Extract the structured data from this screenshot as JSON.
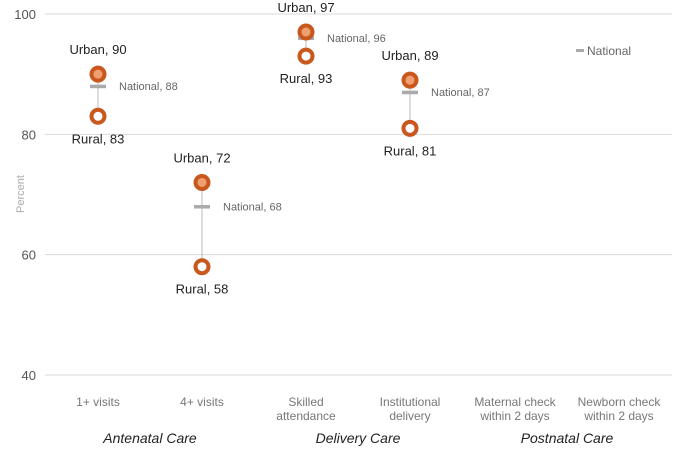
{
  "chart_data": {
    "type": "scatter",
    "ylabel": "Percent",
    "ylim": [
      40,
      100
    ],
    "yticks": [
      "40",
      "60",
      "80",
      "100"
    ],
    "grid": true,
    "legend_position": "top-right",
    "categories": [
      {
        "lines": [
          "1+ visits"
        ]
      },
      {
        "lines": [
          "4+ visits"
        ]
      },
      {
        "lines": [
          "Skilled",
          "attendance"
        ]
      },
      {
        "lines": [
          "Institutional",
          "delivery"
        ]
      },
      {
        "lines": [
          "Maternal check",
          "within 2 days"
        ]
      },
      {
        "lines": [
          "Newborn check",
          "within 2 days"
        ]
      }
    ],
    "groups": [
      {
        "label": "Antenatal Care",
        "categories": [
          0,
          1
        ]
      },
      {
        "label": "Delivery Care",
        "categories": [
          2,
          3
        ]
      },
      {
        "label": "Postnatal Care",
        "categories": [
          4,
          5
        ]
      }
    ],
    "series": [
      {
        "name": "Urban",
        "values": [
          90,
          72,
          97,
          89,
          null,
          null
        ],
        "labels": [
          "Urban, 90",
          "Urban, 72",
          "Urban, 97",
          "Urban, 89",
          null,
          null
        ]
      },
      {
        "name": "Rural",
        "values": [
          83,
          58,
          93,
          81,
          null,
          null
        ],
        "labels": [
          "Rural, 83",
          "Rural, 58",
          "Rural, 93",
          "Rural, 81",
          null,
          null
        ]
      },
      {
        "name": "National",
        "values": [
          88,
          68,
          96,
          87,
          null,
          null
        ],
        "labels": [
          "National, 88",
          "National, 68",
          "National, 96",
          "National, 87",
          null,
          null
        ]
      }
    ],
    "legend": {
      "label": "National"
    },
    "colors": {
      "ring": "#c8581e",
      "urban_fill": "#f0a070",
      "rural_fill": "#ffffff",
      "national": "#aaaaaa",
      "range_line": "#bbbbbb",
      "grid": "#d9d9d9"
    }
  }
}
